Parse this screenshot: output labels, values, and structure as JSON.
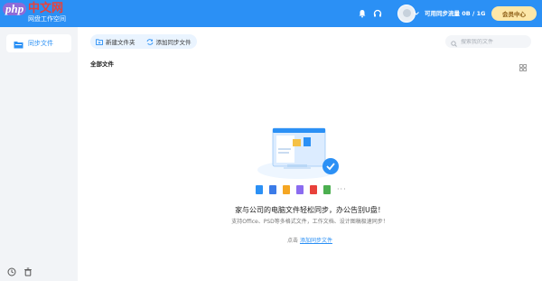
{
  "header": {
    "logo_php": "php",
    "logo_cn": "中文网",
    "app_title": "网盘工作空间",
    "quota_text": "可用同步流量 0B / 1G",
    "member_button": "会员中心",
    "icons": [
      "bell-icon",
      "headset-icon",
      "chevron-down-icon"
    ],
    "accent": "#2b90f5"
  },
  "sidebar": {
    "items": [
      {
        "label": "同步文件",
        "icon": "folder-icon"
      }
    ],
    "bottom_icons": [
      "clock-icon",
      "trash-icon"
    ]
  },
  "toolbar": {
    "new_folder": "新建文件夹",
    "add_sync_file": "添加同步文件",
    "search_placeholder": "搜索我的文件"
  },
  "main": {
    "section_title": "全部文件",
    "empty_title": "家与公司的电脑文件轻松同步，办公告别U盘！",
    "empty_sub": "支持Office、PSD等多格式文件，工作文档、设计图稿极速同步！",
    "hint_prefix": "点击",
    "hint_link": "添加同步文件"
  }
}
